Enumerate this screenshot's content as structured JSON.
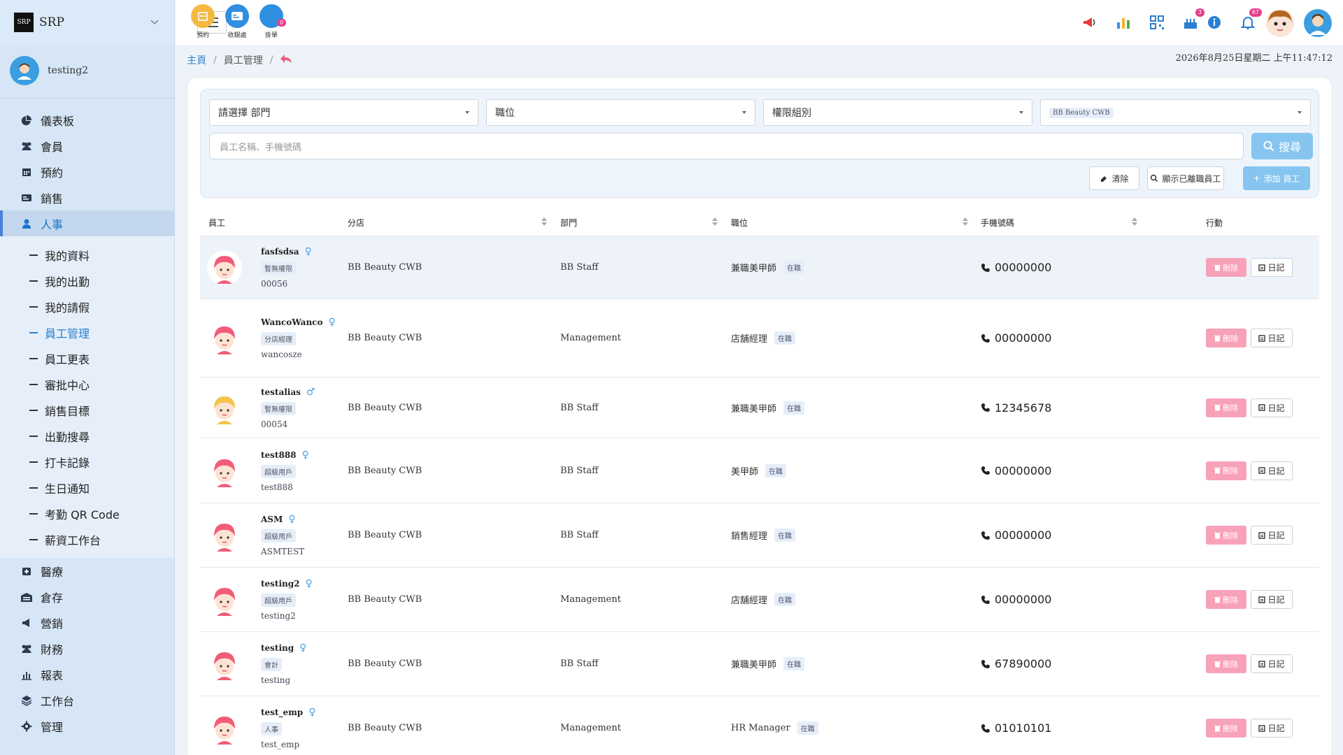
{
  "app": {
    "brand": "SRP",
    "logo_text": "SRP"
  },
  "user": {
    "name": "testing2"
  },
  "sidebar": {
    "items_top": [
      {
        "label": "儀表板",
        "icon": "pie-chart-icon"
      },
      {
        "label": "會員",
        "icon": "users-icon"
      },
      {
        "label": "預約",
        "icon": "calendar-icon"
      },
      {
        "label": "銷售",
        "icon": "card-icon"
      },
      {
        "label": "人事",
        "icon": "user-icon"
      }
    ],
    "sub_items": [
      "我的資料",
      "我的出勤",
      "我的請假",
      "員工管理",
      "員工更表",
      "審批中心",
      "銷售目標",
      "出勤搜尋",
      "打卡記錄",
      "生日通知",
      "考勤 QR Code",
      "薪資工作台"
    ],
    "items_bottom": [
      {
        "label": "醫療",
        "icon": "medical-icon"
      },
      {
        "label": "倉存",
        "icon": "warehouse-icon"
      },
      {
        "label": "營銷",
        "icon": "megaphone-icon"
      },
      {
        "label": "財務",
        "icon": "users-icon"
      },
      {
        "label": "報表",
        "icon": "bar-chart-icon"
      },
      {
        "label": "工作台",
        "icon": "layers-icon"
      },
      {
        "label": "管理",
        "icon": "gear-icon"
      }
    ]
  },
  "topbar": {
    "quick": [
      {
        "label": "預約",
        "color": "#f5b942"
      },
      {
        "label": "收銀處",
        "color": "#2f8fe0"
      },
      {
        "label": "掛單",
        "color": "#2f8fe0",
        "badge": "0"
      }
    ],
    "badges": {
      "cake": "3",
      "bell": "67"
    }
  },
  "breadcrumb": {
    "home": "主頁",
    "current": "員工管理"
  },
  "datetime": "2026年8月25日星期二 上午11:47:12",
  "filters": {
    "department_placeholder": "請選擇 部門",
    "position_placeholder": "職位",
    "permission_placeholder": "權限組別",
    "branch_selected": "BB Beauty CWB",
    "search_placeholder": "員工名稱、手機號碼",
    "search_button": "搜尋",
    "clear_button": "清除",
    "show_left_button": "顯示已離職員工",
    "add_button": "添加 員工"
  },
  "table": {
    "headers": {
      "employee": "員工",
      "branch": "分店",
      "department": "部門",
      "position": "職位",
      "phone": "手機號碼",
      "actions": "行動"
    },
    "delete_label": "刪除",
    "log_label": "日記",
    "rows": [
      {
        "name": "fasfsdsa",
        "gender": "♀",
        "role": "暫無權限",
        "id": "00056",
        "branch": "BB Beauty CWB",
        "department": "BB Staff",
        "position": "兼職美甲師",
        "status": "在職",
        "phone": "00000000",
        "hair": "#f25c7a"
      },
      {
        "name": "WancoWanco",
        "gender": "♀",
        "role": "分店經理",
        "id": "wancosze",
        "branch": "BB Beauty CWB",
        "department": "Management",
        "position": "店舖經理",
        "status": "在職",
        "phone": "00000000",
        "hair": "#f25c7a"
      },
      {
        "name": "testalias",
        "gender": "♂",
        "role": "暫無權限",
        "id": "00054",
        "branch": "BB Beauty CWB",
        "department": "BB Staff",
        "position": "兼職美甲師",
        "status": "在職",
        "phone": "12345678",
        "hair": "#f5c24a"
      },
      {
        "name": "test888",
        "gender": "♀",
        "role": "超級用戶",
        "id": "test888",
        "branch": "BB Beauty CWB",
        "department": "BB Staff",
        "position": "美甲師",
        "status": "在職",
        "phone": "00000000",
        "hair": "#f25c7a"
      },
      {
        "name": "ASM",
        "gender": "♀",
        "role": "超級用戶",
        "id": "ASMTEST",
        "branch": "BB Beauty CWB",
        "department": "BB Staff",
        "position": "銷售經理",
        "status": "在職",
        "phone": "00000000",
        "hair": "#f25c7a"
      },
      {
        "name": "testing2",
        "gender": "♀",
        "role": "超級用戶",
        "id": "testing2",
        "branch": "BB Beauty CWB",
        "department": "Management",
        "position": "店舖經理",
        "status": "在職",
        "phone": "00000000",
        "hair": "#f25c7a"
      },
      {
        "name": "testing",
        "gender": "♀",
        "role": "會計",
        "id": "testing",
        "branch": "BB Beauty CWB",
        "department": "BB Staff",
        "position": "兼職美甲師",
        "status": "在職",
        "phone": "67890000",
        "hair": "#f25c7a"
      },
      {
        "name": "test_emp",
        "gender": "♀",
        "role": "人事",
        "id": "test_emp",
        "branch": "BB Beauty CWB",
        "department": "Management",
        "position": "HR Manager",
        "status": "在職",
        "phone": "01010101",
        "hair": "#f25c7a"
      }
    ]
  }
}
